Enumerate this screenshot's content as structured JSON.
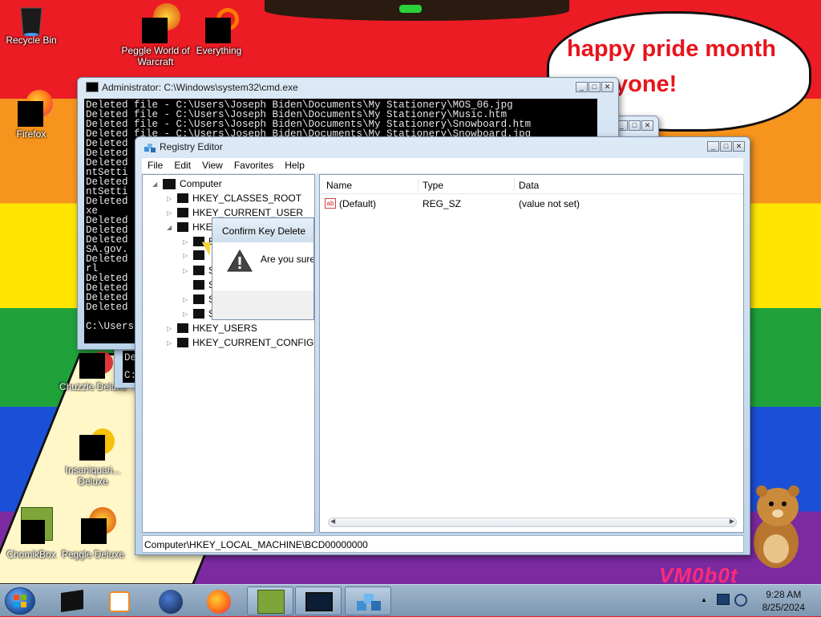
{
  "desktop": {
    "banner_line1": "happy pride month",
    "banner_line2": "yone!",
    "watermark": "VM0b0t",
    "icons": [
      {
        "label": "Recycle Bin",
        "name": "recycle-bin"
      },
      {
        "label": "Peggle World of Warcraft",
        "name": "peggle-wow"
      },
      {
        "label": "Everything",
        "name": "everything"
      },
      {
        "label": "Firefox",
        "name": "firefox"
      },
      {
        "label": "Chuzzle Deluxe",
        "name": "chuzzle-deluxe"
      },
      {
        "label": "Insaniquari... Deluxe",
        "name": "insaniquarium-deluxe"
      },
      {
        "label": "ChomikBox",
        "name": "chomikbox"
      },
      {
        "label": "Peggle Deluxe",
        "name": "peggle-deluxe"
      }
    ]
  },
  "cmd": {
    "title": "Administrator: C:\\Windows\\system32\\cmd.exe",
    "lines": [
      "Deleted file - C:\\Users\\Joseph Biden\\Documents\\My Stationery\\MOS_06.jpg",
      "Deleted file - C:\\Users\\Joseph Biden\\Documents\\My Stationery\\Music.htm",
      "Deleted file - C:\\Users\\Joseph Biden\\Documents\\My Stationery\\Snowboard.htm",
      "Deleted file - C:\\Users\\Joseph Biden\\Documents\\My Stationery\\Snowboard.jpg",
      "Deleted",
      "Deleted",
      "Deleted",
      "ntSetti",
      "Deleted",
      "ntSetti",
      "Deleted",
      "xe",
      "Deleted",
      "Deleted",
      "Deleted",
      "SA.gov.",
      "Deleted",
      "rl",
      "Deleted",
      "Deleted",
      "Deleted",
      "Deleted",
      "",
      "C:\\Users"
    ],
    "back_lines": [
      "De",
      "C:"
    ]
  },
  "regedit": {
    "title": "Registry Editor",
    "menu": [
      "File",
      "Edit",
      "View",
      "Favorites",
      "Help"
    ],
    "tree": {
      "root": "Computer",
      "keys": [
        "HKEY_CLASSES_ROOT",
        "HKEY_CURRENT_USER",
        "HKE",
        "HKEY_USERS",
        "HKEY_CURRENT_CONFIG"
      ],
      "subkeys": [
        "B",
        "",
        "S",
        "S",
        "S",
        "S"
      ]
    },
    "columns": {
      "name": "Name",
      "type": "Type",
      "data": "Data"
    },
    "values": [
      {
        "name": "(Default)",
        "type": "REG_SZ",
        "data": "(value not set)",
        "icon": "string-value-icon"
      }
    ],
    "status_path": "Computer\\HKEY_LOCAL_MACHINE\\BCD00000000"
  },
  "dialog": {
    "title": "Confirm Key Delete",
    "message": "Are you sure",
    "icon": "warning-icon"
  },
  "taskbar": {
    "time": "9:28 AM",
    "date": "8/25/2024",
    "apps": [
      "cmd",
      "media-player",
      "globe",
      "firefox",
      "chomikbox",
      "cmd-window",
      "registry-editor"
    ]
  }
}
